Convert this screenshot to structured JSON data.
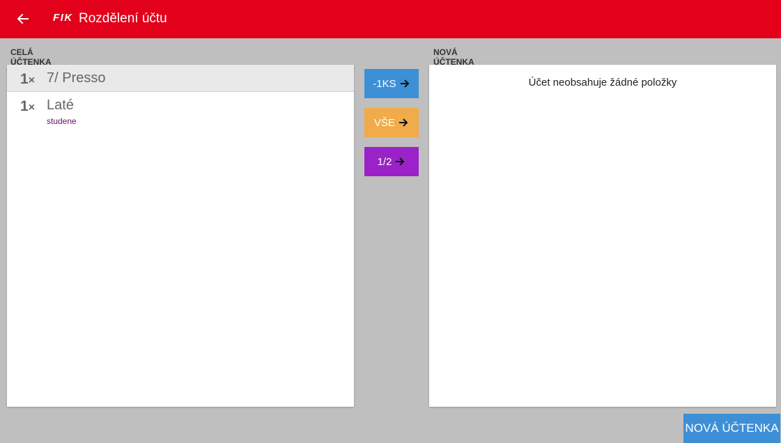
{
  "header": {
    "brand": "FIK",
    "title": "Rozdělení účtu",
    "back_icon": "arrow-left-icon",
    "color": "#e2001a"
  },
  "left_panel": {
    "label": "CELÁ ÚČTENKA",
    "items": [
      {
        "qty": "1",
        "qty_suffix": "×",
        "name": "7/ Presso",
        "note": "",
        "selected": true
      },
      {
        "qty": "1",
        "qty_suffix": "×",
        "name": "Laté",
        "note": "studene",
        "selected": false
      }
    ]
  },
  "middle_buttons": {
    "one_label": "-1KS",
    "all_label": "VŠE",
    "half_label": "1/2",
    "arrow_icon": "arrow-right-icon",
    "colors": {
      "one": "#3d8fd6",
      "all": "#f0ab4a",
      "half": "#9b22c8"
    }
  },
  "right_panel": {
    "label": "NOVÁ ÚČTENKA",
    "empty_message": "Účet neobsahuje žádné položky"
  },
  "footer": {
    "new_receipt_label": "NOVÁ ÚČTENKA"
  }
}
